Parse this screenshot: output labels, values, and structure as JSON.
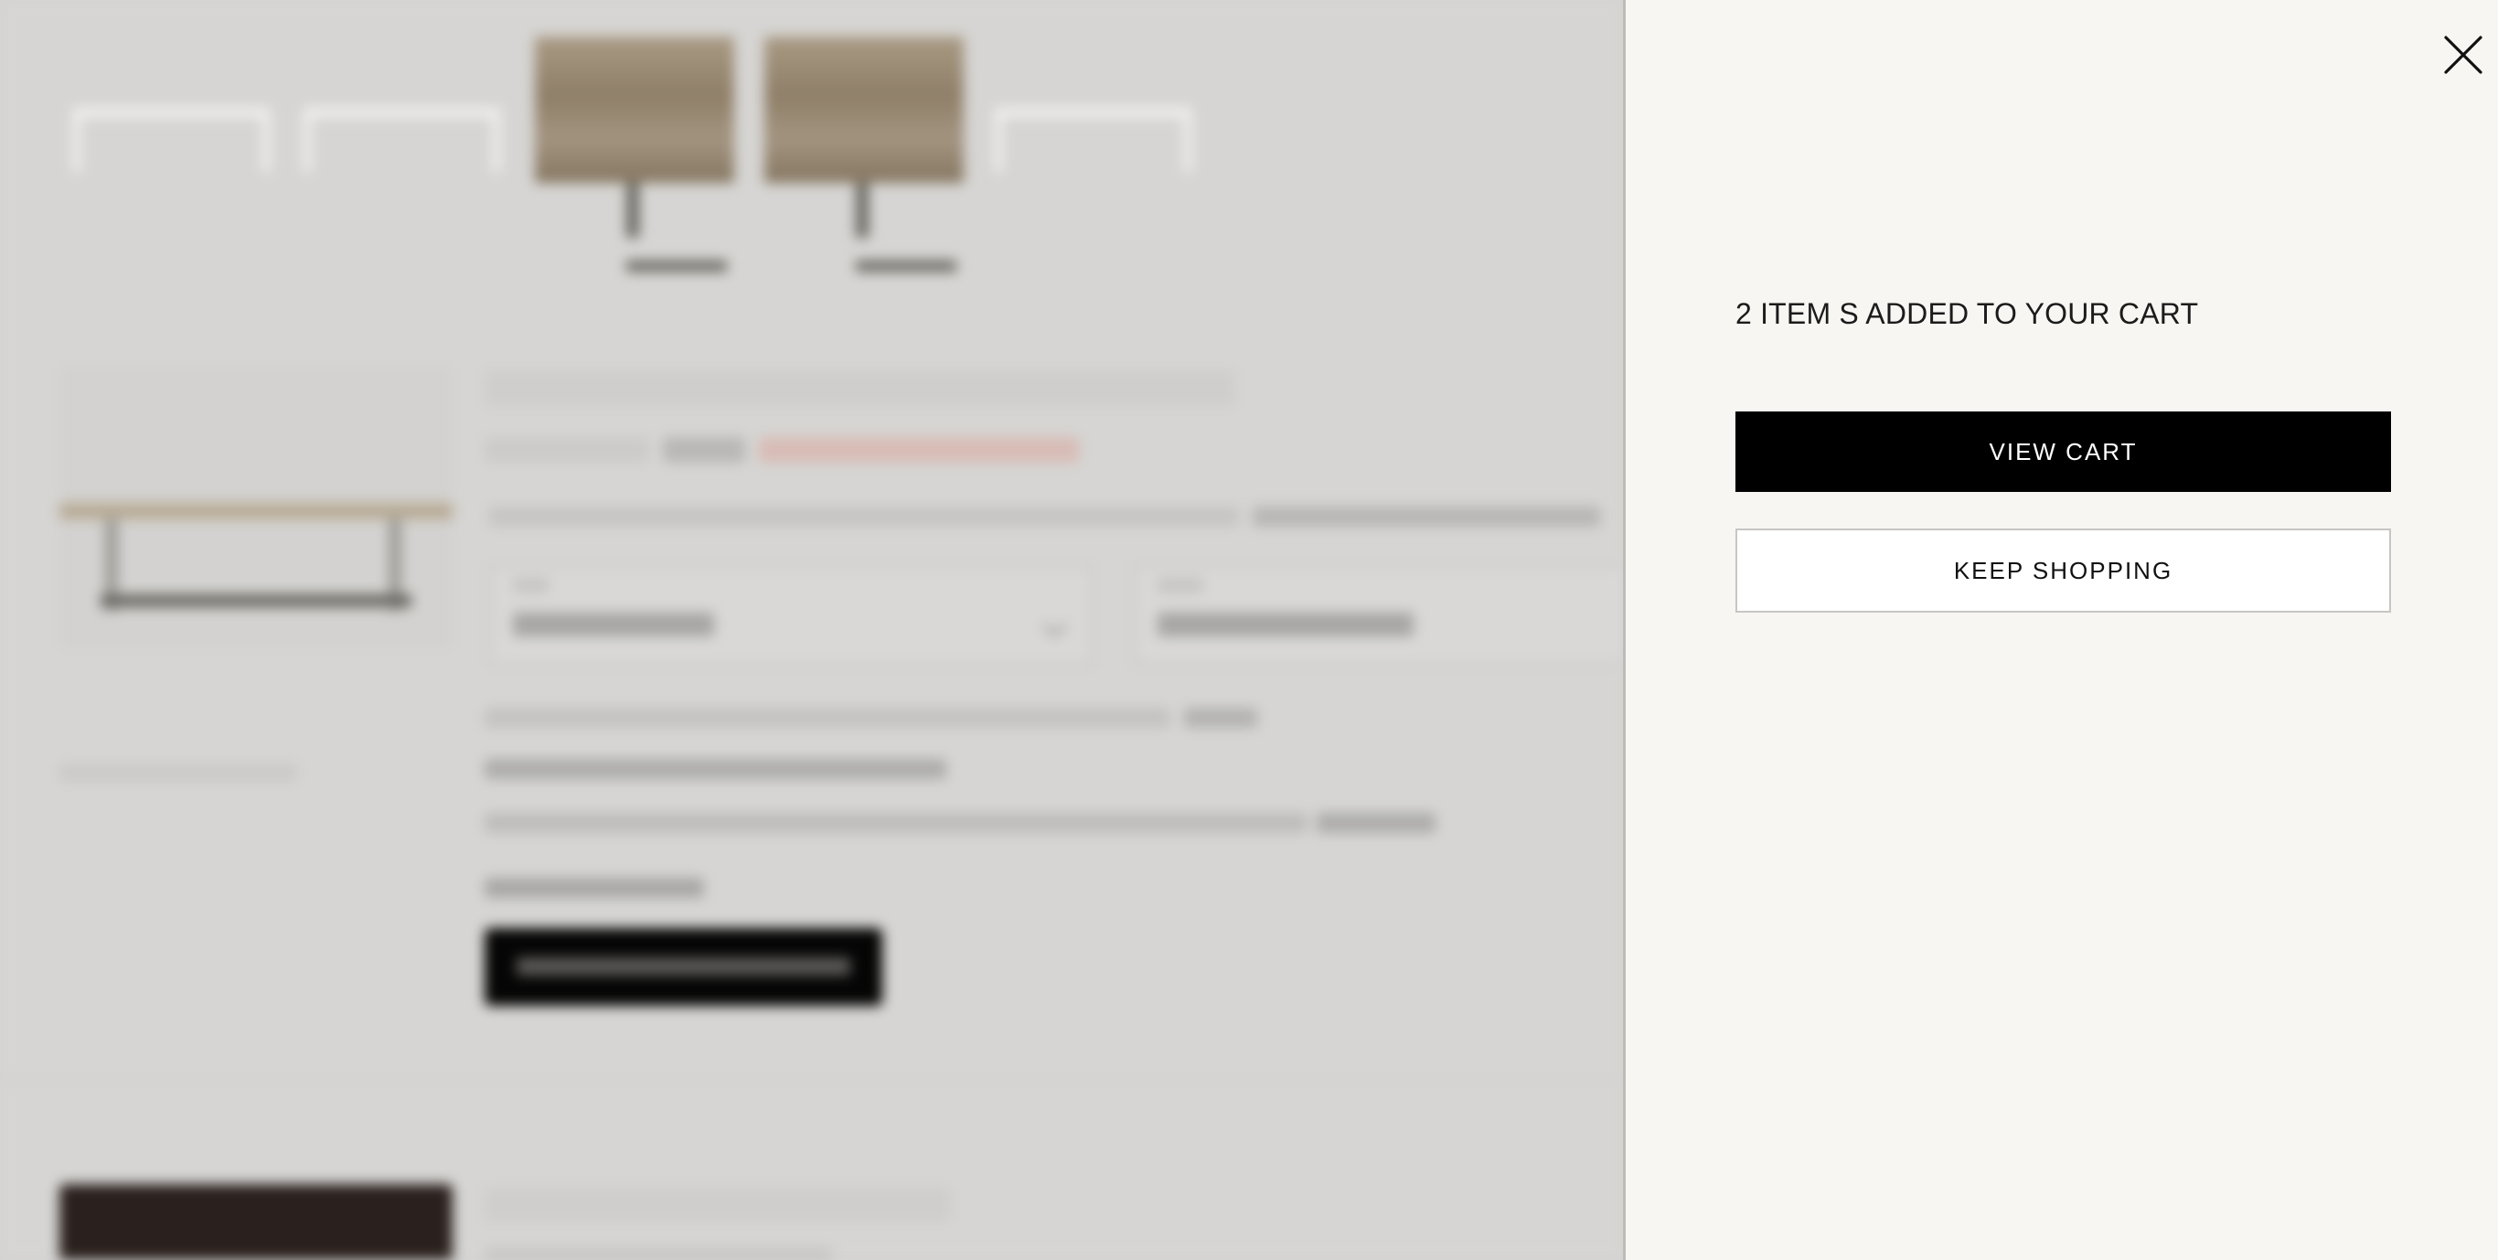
{
  "drawer": {
    "heading": "2 ITEM S ADDED TO YOUR CART",
    "view_cart_label": "VIEW CART",
    "keep_shopping_label": "KEEP SHOPPING",
    "close_icon": "close-icon"
  },
  "colors": {
    "drawer_bg": "#f7f6f2",
    "primary_button": "#000000",
    "secondary_button": "#ffffff",
    "page_overlay": "#d4d3d1"
  }
}
